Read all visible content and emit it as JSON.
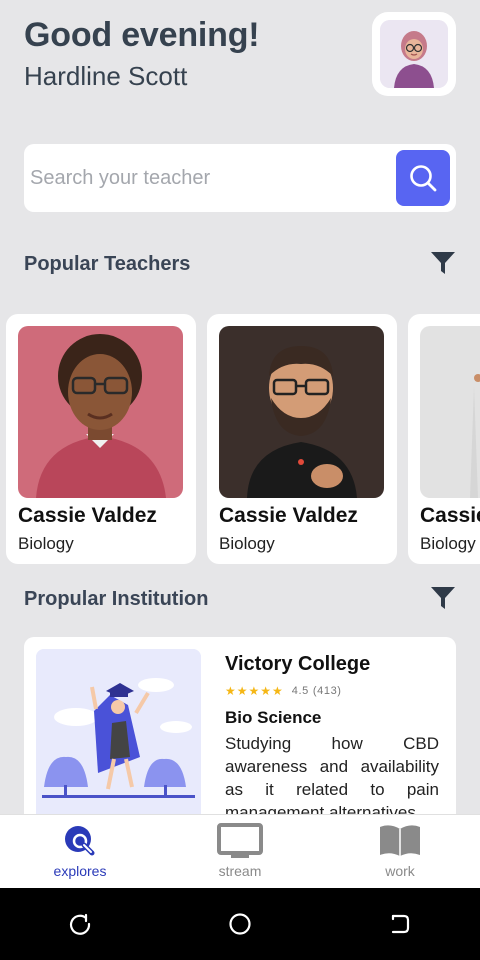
{
  "header": {
    "greeting": "Good evening!",
    "user_name": "Hardline Scott",
    "avatar_icon": "user-avatar"
  },
  "search": {
    "placeholder": "Search your teacher",
    "button_icon": "search-icon",
    "accent_color": "#5865f2"
  },
  "popular_teachers": {
    "title": "Popular Teachers",
    "filter_icon": "filter-icon",
    "cards": [
      {
        "name": "Cassie Valdez",
        "subject": "Biology",
        "photo_bg": "#cf6b7a"
      },
      {
        "name": "Cassie Valdez",
        "subject": "Biology",
        "photo_bg": "#3b2f2b"
      },
      {
        "name": "Cassie Valdez",
        "subject": "Biology",
        "photo_bg": "#e2e2e2"
      }
    ]
  },
  "popular_institution": {
    "title": "Propular Institution",
    "filter_icon": "filter-icon",
    "card": {
      "name": "Victory College",
      "rating": "4.5",
      "reviews": "(413)",
      "stars": "★★★★★",
      "department": "Bio Science",
      "description": "Studying how CBD awareness and availability as it related to pain management alternatives."
    }
  },
  "bottom_nav": {
    "items": [
      {
        "label": "explores",
        "icon": "explore-search-icon",
        "active": true
      },
      {
        "label": "stream",
        "icon": "monitor-icon",
        "active": false
      },
      {
        "label": "work",
        "icon": "book-icon",
        "active": false
      }
    ],
    "active_color": "#2a3ab8"
  },
  "system_nav": {
    "icons": [
      "recent-apps-icon",
      "home-icon",
      "back-icon"
    ]
  }
}
